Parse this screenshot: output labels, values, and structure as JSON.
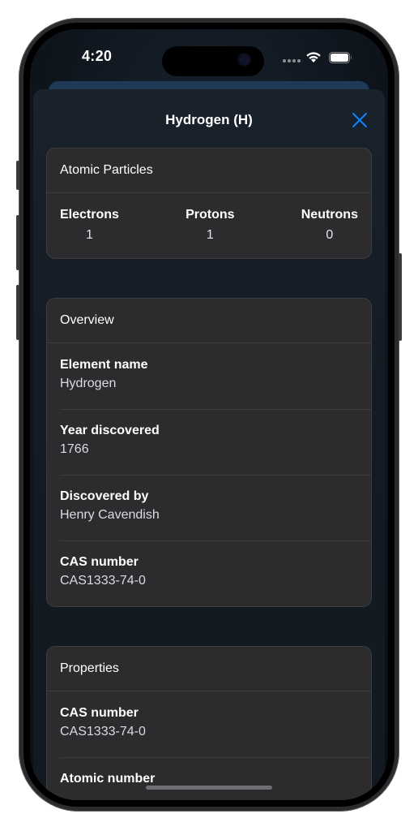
{
  "status_bar": {
    "time": "4:20",
    "icons": [
      "signal-dots-icon",
      "wifi-icon",
      "battery-icon"
    ]
  },
  "sheet": {
    "title": "Hydrogen (H)",
    "close_icon": "close-icon",
    "accent_color": "#0a84ff"
  },
  "atomic_particles": {
    "header": "Atomic Particles",
    "items": [
      {
        "label": "Electrons",
        "value": "1"
      },
      {
        "label": "Protons",
        "value": "1"
      },
      {
        "label": "Neutrons",
        "value": "0"
      }
    ]
  },
  "overview": {
    "header": "Overview",
    "rows": [
      {
        "label": "Element name",
        "value": "Hydrogen"
      },
      {
        "label": "Year discovered",
        "value": "1766"
      },
      {
        "label": "Discovered by",
        "value": "Henry Cavendish"
      },
      {
        "label": "CAS number",
        "value": "CAS1333-74-0"
      }
    ]
  },
  "properties": {
    "header": "Properties",
    "rows": [
      {
        "label": "CAS number",
        "value": "CAS1333-74-0"
      },
      {
        "label": "Atomic number",
        "value": ""
      }
    ]
  },
  "colors": {
    "card_background": "#2c2c2e",
    "sheet_background": "#141b24"
  }
}
